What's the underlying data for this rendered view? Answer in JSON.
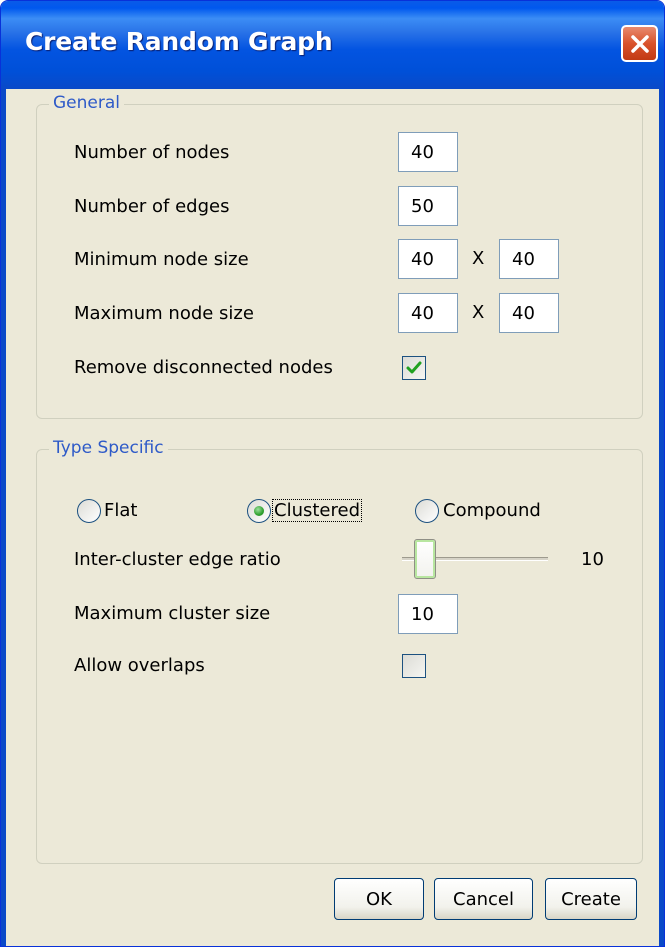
{
  "window": {
    "title": "Create Random Graph"
  },
  "general": {
    "legend": "General",
    "num_nodes_label": "Number of nodes",
    "num_nodes_value": "40",
    "num_edges_label": "Number of edges",
    "num_edges_value": "50",
    "min_size_label": "Minimum node size",
    "min_size_w": "40",
    "min_size_h": "40",
    "max_size_label": "Maximum node size",
    "max_size_w": "40",
    "max_size_h": "40",
    "times_symbol": "X",
    "remove_disconnected_label": "Remove disconnected nodes",
    "remove_disconnected_checked": true
  },
  "type_specific": {
    "legend": "Type Specific",
    "radio_options": [
      "Flat",
      "Clustered",
      "Compound"
    ],
    "selected": "Clustered",
    "inter_cluster_label": "Inter-cluster edge ratio",
    "inter_cluster_value": "10",
    "inter_cluster_fraction": 0.1,
    "max_cluster_label": "Maximum cluster size",
    "max_cluster_value": "10",
    "allow_overlaps_label": "Allow overlaps",
    "allow_overlaps_checked": false
  },
  "buttons": {
    "ok": "OK",
    "cancel": "Cancel",
    "create": "Create"
  },
  "colors": {
    "title_bar": "#0054E3",
    "dialog_bg": "#ECE9D8",
    "group_legend": "#2E5AC8",
    "close_button": "#D9522B",
    "check_mark": "#21A121"
  },
  "icons": {
    "close": "close-icon",
    "check": "check-icon"
  }
}
